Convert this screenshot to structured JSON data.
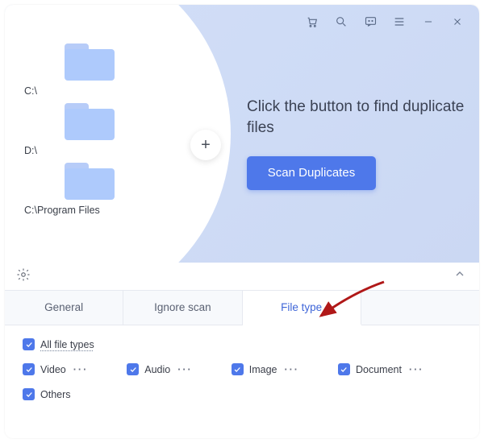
{
  "titlebar": {
    "icons": [
      "cart-icon",
      "search-icon",
      "feedback-icon",
      "menu-icon",
      "minimize-icon",
      "close-icon"
    ]
  },
  "drives": [
    {
      "label": "C:\\"
    },
    {
      "label": "D:\\"
    },
    {
      "label": "C:\\Program Files"
    }
  ],
  "add_button_glyph": "+",
  "cta": {
    "heading": "Click the button to find duplicate files",
    "scan_label": "Scan Duplicates"
  },
  "tabs": {
    "general": "General",
    "ignore": "Ignore scan",
    "filetype": "File type",
    "active": "filetype"
  },
  "filters": {
    "all": "All file types",
    "video": "Video",
    "audio": "Audio",
    "image": "Image",
    "document": "Document",
    "others": "Others",
    "more_glyph": "···"
  },
  "colors": {
    "accent": "#4e78ea",
    "pane_bg": "#d2def8",
    "folder": "#aecafc"
  }
}
